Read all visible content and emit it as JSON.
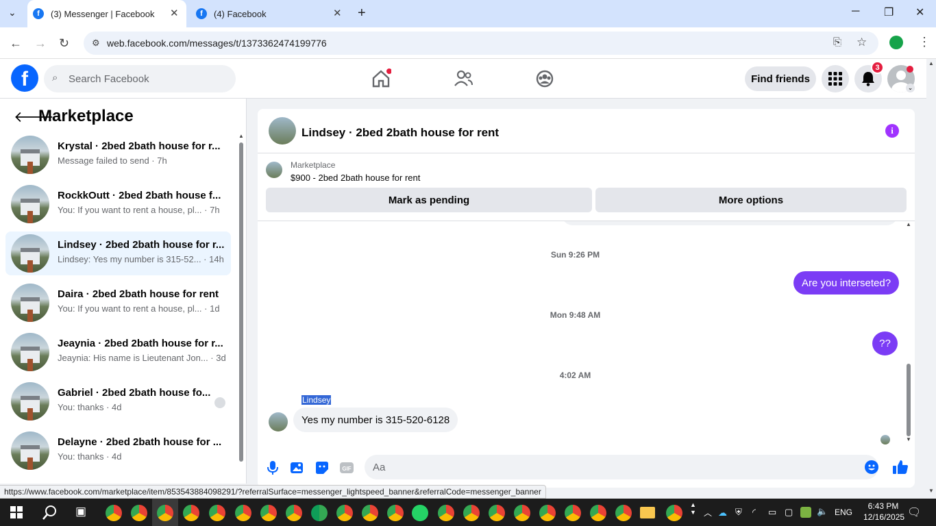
{
  "browser": {
    "tabs": [
      {
        "title": "(3) Messenger | Facebook",
        "active": true
      },
      {
        "title": "(4) Facebook",
        "active": false
      }
    ],
    "url": "web.facebook.com/messages/t/1373362474199776",
    "status_url": "https://www.facebook.com/marketplace/item/853543884098291/?referralSurface=messenger_lightspeed_banner&referralCode=messenger_banner"
  },
  "fb_header": {
    "logo_letter": "f",
    "search_placeholder": "Search Facebook",
    "find_friends_label": "Find friends",
    "notifications_count": "3"
  },
  "left_panel": {
    "title": "Marketplace",
    "conversations": [
      {
        "name": "Krystal · 2bed 2bath house for r...",
        "preview": "Message failed to send · 7h",
        "active": false
      },
      {
        "name": "RockkOutt · 2bed 2bath house f...",
        "preview": "You: If you want to rent a house, pl... · 7h",
        "active": false
      },
      {
        "name": "Lindsey · 2bed 2bath house for r...",
        "preview": "Lindsey: Yes my number is 315-52... · 14h",
        "active": true
      },
      {
        "name": "Daira · 2bed 2bath house for rent",
        "preview": "You: If you want to rent a house, pl... · 1d",
        "active": false
      },
      {
        "name": "Jeaynia · 2bed 2bath house for r...",
        "preview": "Jeaynia: His name is Lieutenant Jon... · 3d",
        "active": false
      },
      {
        "name": "Gabriel · 2bed 2bath house fo...",
        "preview": "You: thanks · 4d",
        "active": false
      },
      {
        "name": "Delayne · 2bed 2bath house for ...",
        "preview": "You: thanks · 4d",
        "active": false
      }
    ]
  },
  "chat": {
    "title": "Lindsey · 2bed 2bath house for rent",
    "marketplace_label": "Marketplace",
    "listing": "$900 - 2bed 2bath house for rent",
    "mark_pending_label": "Mark as pending",
    "more_options_label": "More options",
    "timestamps": [
      "Sun 9:26 PM",
      "Mon 9:48 AM",
      "4:02 AM"
    ],
    "outgoing": [
      "Are you interseted?",
      "??"
    ],
    "sender_name": "Lindsey",
    "incoming": "Yes my number is 315-520-6128",
    "input_placeholder": "Aa"
  },
  "taskbar": {
    "language": "ENG",
    "time": "6:43 PM",
    "date": "12/16/2025"
  },
  "colors": {
    "fb_blue": "#0866ff",
    "bubble_purple": "#7b3cf5",
    "active_conv": "#ebf5ff"
  }
}
